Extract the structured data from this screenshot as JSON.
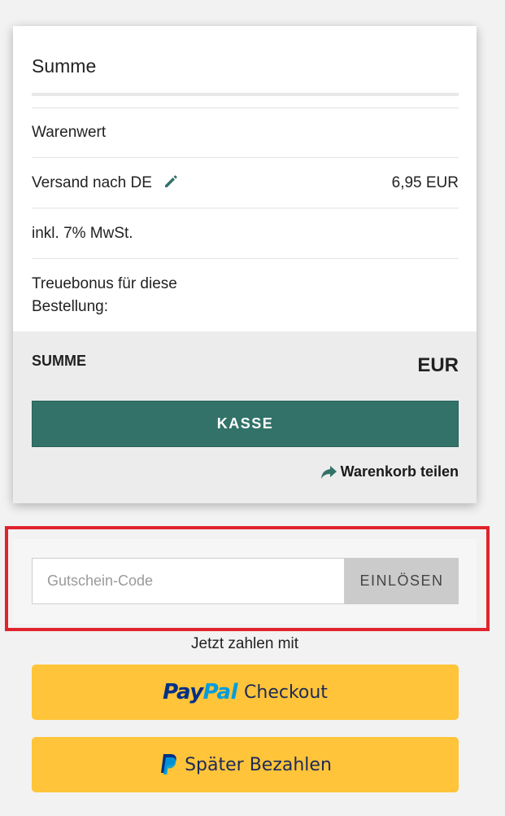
{
  "summary": {
    "title": "Summe",
    "rows": [
      {
        "label": "Warenwert",
        "value": ""
      },
      {
        "label": "Versand nach DE",
        "value": "6,95 EUR"
      },
      {
        "label": "inkl. 7% MwSt.",
        "value": ""
      },
      {
        "label_line1": "Treuebonus für diese",
        "label_line2": "Bestellung:",
        "value": ""
      }
    ],
    "total_label": "SUMME",
    "total_value": "EUR",
    "checkout_label": "KASSE",
    "share_label": "Warenkorb teilen"
  },
  "coupon": {
    "placeholder": "Gutschein-Code",
    "value": "",
    "redeem_label": "EINLÖSEN"
  },
  "payment": {
    "heading": "Jetzt zahlen mit",
    "paypal": {
      "brand_pay": "Pay",
      "brand_pal": "Pal",
      "label": "Checkout"
    },
    "paylater": {
      "label": "Später Bezahlen"
    }
  },
  "colors": {
    "accent": "#327269",
    "paypal_yellow": "#ffc439",
    "highlight": "#e0232c"
  },
  "icons": {
    "edit": "pencil-icon",
    "share": "share-arrow-icon",
    "paypal": "paypal-logo-icon"
  }
}
